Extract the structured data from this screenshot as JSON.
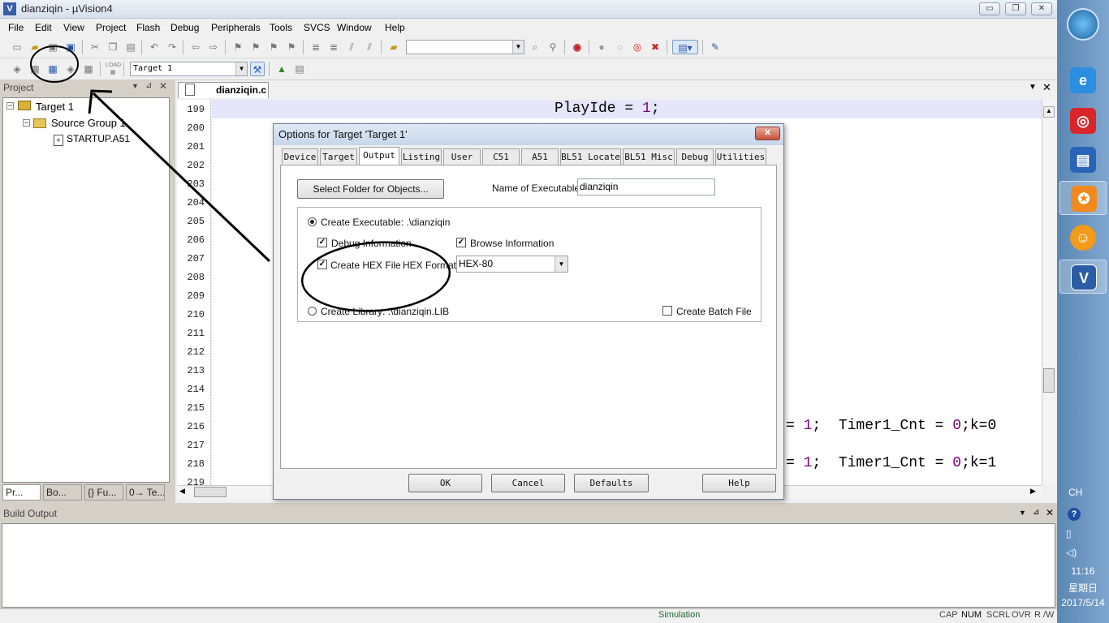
{
  "window": {
    "title": "dianziqin - µVision4",
    "minimize": "▭",
    "restore": "❐",
    "close": "✕"
  },
  "menu": [
    "File",
    "Edit",
    "View",
    "Project",
    "Flash",
    "Debug",
    "Peripherals",
    "Tools",
    "SVCS",
    "Window",
    "Help"
  ],
  "toolbar2": {
    "target_select": "Target 1"
  },
  "project_panel": {
    "title": "Project",
    "tree": {
      "root": "Target 1",
      "group": "Source Group 1",
      "file": "STARTUP.A51"
    },
    "tabs": [
      "Pr...",
      "Bo...",
      "{} Fu...",
      "0→ Te..."
    ]
  },
  "editor": {
    "tab": "dianziqin.c",
    "line_numbers": [
      "199",
      "200",
      "201",
      "202",
      "203",
      "204",
      "205",
      "206",
      "207",
      "208",
      "209",
      "210",
      "211",
      "212",
      "213",
      "214",
      "215",
      "216",
      "217",
      "218",
      "219"
    ],
    "code_line_199_pre": "PlayIde = ",
    "code_line_199_num": "1",
    "code_line_199_post": ";",
    "code_line_216_pre": "= ",
    "code_line_216_num": "1",
    "code_line_216_mid": ";  Timer1_Cnt = ",
    "code_line_216_num2": "0",
    "code_line_216_post": ";k=0",
    "code_line_218_pre": "= ",
    "code_line_218_num": "1",
    "code_line_218_mid": ";  Timer1_Cnt = ",
    "code_line_218_num2": "0",
    "code_line_218_post": ";k=1"
  },
  "dialog": {
    "title": "Options for Target 'Target 1'",
    "tabs": [
      "Device",
      "Target",
      "Output",
      "Listing",
      "User",
      "C51",
      "A51",
      "BL51 Locate",
      "BL51 Misc",
      "Debug",
      "Utilities"
    ],
    "active_tab": "Output",
    "select_folder_button": "Select Folder for Objects...",
    "name_of_executable_label": "Name of Executable:",
    "name_of_executable_value": "dianziqin",
    "create_executable_label": "Create Executable:  .\\dianziqin",
    "debug_info_label": "Debug Information",
    "browse_info_label": "Browse Information",
    "create_hex_label": "Create HEX File",
    "hex_format_label": "HEX Format:",
    "hex_format_value": "HEX-80",
    "create_library_label": "Create Library:  .\\dianziqin.LIB",
    "create_batch_label": "Create Batch File",
    "ok_button": "OK",
    "cancel_button": "Cancel",
    "defaults_button": "Defaults",
    "help_button": "Help",
    "debug_info_checked": true,
    "browse_info_checked": true,
    "create_hex_checked": true,
    "create_batch_checked": false,
    "executable_selected": true
  },
  "build_output": {
    "title": "Build Output"
  },
  "statusbar": {
    "mode": "Simulation",
    "cap": "CAP",
    "num": "NUM",
    "scrl": "SCRL",
    "ovr": "OVR",
    "rw": "R /W"
  },
  "taskbar": {
    "lang": "CH",
    "time": "11:16",
    "weekday": "星期日",
    "date": "2017/5/14"
  }
}
